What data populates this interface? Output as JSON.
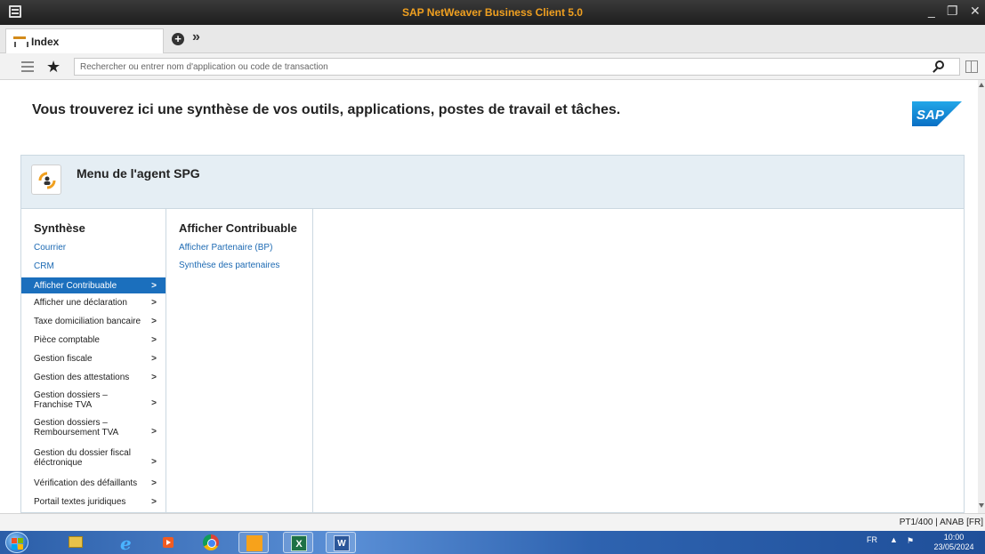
{
  "window": {
    "title": "SAP NetWeaver Business Client 5.0"
  },
  "tabs": [
    {
      "label": "Index",
      "icon": "index-icon"
    }
  ],
  "toolbar": {
    "search_placeholder": "Rechercher ou entrer nom d'application ou code de transaction"
  },
  "content": {
    "headline": "Vous trouverez ici une synthèse de vos outils, applications, postes de travail et tâches.",
    "logo_text": "SAP",
    "menu_title": "Menu de l'agent SPG",
    "col1": {
      "title": "Synthèse",
      "links": [
        "Courrier",
        "CRM"
      ],
      "items": [
        "Afficher Contribuable",
        "Afficher une déclaration",
        "Taxe domiciliation bancaire",
        "Pièce comptable",
        "Gestion fiscale",
        "Gestion des attestations",
        "Gestion dossiers – Franchise TVA",
        "Gestion dossiers – Remboursement TVA",
        "Gestion du dossier fiscal éléctronique",
        "Vérification des défaillants",
        "Portail textes juridiques"
      ],
      "selected": "Afficher Contribuable"
    },
    "col2": {
      "title": "Afficher Contribuable",
      "links": [
        "Afficher Partenaire (BP)",
        "Synthèse des partenaires"
      ]
    }
  },
  "status": {
    "text": "PT1/400 | ANAB [FR]"
  },
  "taskbar": {
    "language": "FR",
    "time": "10:00",
    "date": "23/05/2024"
  },
  "colors": {
    "accent": "#1b6fbd",
    "title_text": "#f0a020",
    "header_bg": "#e5eef4"
  }
}
